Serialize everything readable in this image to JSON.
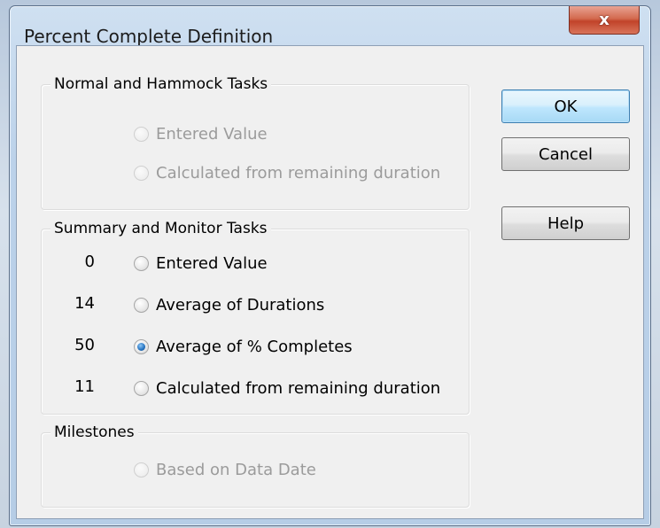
{
  "dialog": {
    "title": "Percent Complete Definition",
    "close_label": "x"
  },
  "groups": {
    "normal": {
      "label": "Normal and Hammock Tasks",
      "options": [
        {
          "label": "Entered Value",
          "checked": false,
          "disabled": true
        },
        {
          "label": "Calculated from remaining duration",
          "checked": false,
          "disabled": true
        }
      ]
    },
    "summary": {
      "label": "Summary and Monitor Tasks",
      "options": [
        {
          "count": "0",
          "label": "Entered Value",
          "checked": false
        },
        {
          "count": "14",
          "label": "Average of Durations",
          "checked": false
        },
        {
          "count": "50",
          "label": "Average of % Completes",
          "checked": true
        },
        {
          "count": "11",
          "label": "Calculated from remaining duration",
          "checked": false
        }
      ]
    },
    "milestones": {
      "label": "Milestones",
      "options": [
        {
          "label": "Based on Data Date",
          "checked": false,
          "disabled": true
        }
      ]
    }
  },
  "buttons": {
    "ok": "OK",
    "cancel": "Cancel",
    "help": "Help"
  }
}
